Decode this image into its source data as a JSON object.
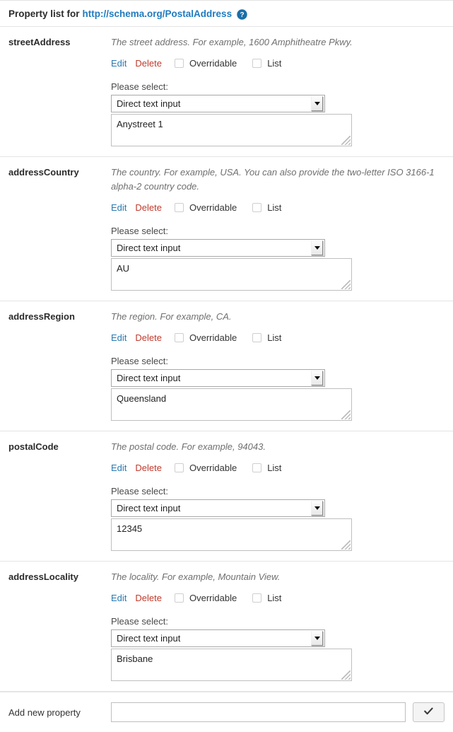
{
  "header": {
    "title": "Property list for",
    "schema_url_label": "http://schema.org/PostalAddress",
    "help_icon": "help-circle-icon",
    "link_color": "#1f7bbf",
    "help_icon_color": "#1a6fa8"
  },
  "common": {
    "edit_label": "Edit",
    "delete_label": "Delete",
    "overridable_label": "Overridable",
    "list_label": "List",
    "select_prompt": "Please select:",
    "edit_color": "#2a7ab0",
    "delete_color": "#c0392b"
  },
  "properties": [
    {
      "name": "streetAddress",
      "description": "The street address. For example, 1600 Amphitheatre Pkwy.",
      "overridable_checked": false,
      "list_checked": false,
      "select_value": "Direct text input",
      "text_value": "Anystreet 1"
    },
    {
      "name": "addressCountry",
      "description": "The country. For example, USA. You can also provide the two-letter ISO 3166-1 alpha-2 country code.",
      "overridable_checked": false,
      "list_checked": false,
      "select_value": "Direct text input",
      "text_value": "AU"
    },
    {
      "name": "addressRegion",
      "description": "The region. For example, CA.",
      "overridable_checked": false,
      "list_checked": false,
      "select_value": "Direct text input",
      "text_value": "Queensland"
    },
    {
      "name": "postalCode",
      "description": "The postal code. For example, 94043.",
      "overridable_checked": false,
      "list_checked": false,
      "select_value": "Direct text input",
      "text_value": "12345"
    },
    {
      "name": "addressLocality",
      "description": "The locality. For example, Mountain View.",
      "overridable_checked": false,
      "list_checked": false,
      "select_value": "Direct text input",
      "text_value": "Brisbane"
    }
  ],
  "footer": {
    "label": "Add new property",
    "input_value": "",
    "input_placeholder": "",
    "submit_icon": "checkmark-icon"
  }
}
